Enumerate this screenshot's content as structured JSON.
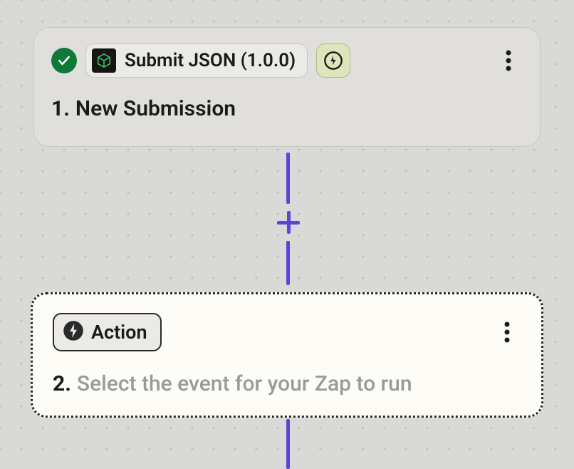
{
  "trigger": {
    "app_name": "Submit JSON (1.0.0)",
    "step_number": "1.",
    "step_title": "New Submission"
  },
  "action": {
    "chip_label": "Action",
    "step_number": "2.",
    "step_title": "Select the event for your Zap to run"
  },
  "colors": {
    "accent": "#5a45da",
    "success": "#0d7a3a",
    "trigger_badge_bg": "#dfe5bb"
  }
}
